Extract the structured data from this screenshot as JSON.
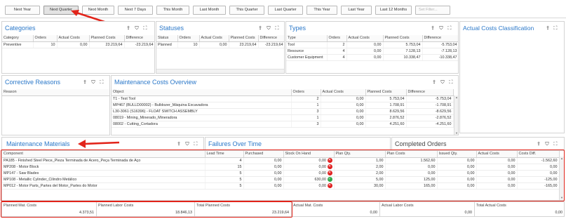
{
  "filters": [
    "Next Year",
    "Next Quarter",
    "Next Month",
    "Next 7 Days",
    "This Month",
    "Last Month",
    "This Quarter",
    "Last Quarter",
    "This Year",
    "Last Year",
    "Last 12 Months"
  ],
  "filter_placeholder": "Set Filter...",
  "panels": {
    "categories": {
      "title": "Categories",
      "headers": [
        "Category",
        "Orders",
        "Actual Costs",
        "Planned Costs",
        "Difference"
      ],
      "rows": [
        [
          "Preventive",
          "10",
          "0,00",
          "23.219,64",
          "-23.219,64"
        ]
      ]
    },
    "statuses": {
      "title": "Statuses",
      "headers": [
        "Status",
        "Orders",
        "Actual Costs",
        "Planned Costs",
        "Difference"
      ],
      "rows": [
        [
          "Planned",
          "10",
          "0,00",
          "23.219,64",
          "-23.219,64"
        ]
      ]
    },
    "types": {
      "title": "Types",
      "headers": [
        "Type",
        "Orders",
        "Actual Costs",
        "Planned Costs",
        "Difference"
      ],
      "rows": [
        [
          "Tool",
          "2",
          "0,00",
          "5.753,04",
          "-5.753,04"
        ],
        [
          "Resource",
          "4",
          "0,00",
          "7.128,13",
          "-7.128,13"
        ],
        [
          "Customer Equipment",
          "4",
          "0,00",
          "10.338,47",
          "-10.338,47"
        ]
      ]
    },
    "actual_costs_classification": {
      "title": "Actual Costs Classification"
    },
    "corrective_reasons": {
      "title": "Corrective Reasons",
      "headers": [
        "Reason"
      ]
    },
    "maintenance_costs_overview": {
      "title": "Maintenance Costs Overview",
      "headers": [
        "Object",
        "Orders",
        "Actual Costs",
        "Planned Costs",
        "Difference"
      ],
      "rows": [
        [
          "T1 - Test Tool",
          "2",
          "0,00",
          "5.753,04",
          "-5.753,04"
        ],
        [
          "MP467 (BULLD00002) - Bulldozer_Máquina Excavadora",
          "1",
          "0,00",
          "1.708,91",
          "-1.708,91"
        ],
        [
          "L30-3061 (S16396) - FLOAT SWITCH ASSEMBLY",
          "3",
          "0,00",
          "8.629,56",
          "-8.629,56"
        ],
        [
          "08019 - Mining_Minerado_Mineradora",
          "1",
          "0,00",
          "2.876,52",
          "-2.876,52"
        ],
        [
          "08002 - Cutting_Cortadora",
          "3",
          "0,00",
          "4.251,60",
          "-4.251,60"
        ]
      ]
    },
    "maintenance_materials": {
      "title": "Maintenance Materials",
      "headers": [
        "Component",
        "Lead Time",
        "Purchased",
        "Stock On Hand",
        "Plan Qty.",
        "Plan Costs",
        "Issued Qty.",
        "Actual Costs",
        "Costs Diff."
      ],
      "rows": [
        [
          "PA185 - Finished Steel Piece_Pieza Terminada de Acero_Peça Terminada de Aço",
          "4",
          "0,00",
          "0,00",
          "bad",
          "1,00",
          "1.562,60",
          "0,00",
          "0,00",
          "-1.562,60"
        ],
        [
          "MP208 - Motor Block",
          "15",
          "0,00",
          "0,00",
          "bad",
          "2,00",
          "0,00",
          "0,00",
          "0,00",
          "0,00"
        ],
        [
          "MP147 - Saw Blades",
          "5",
          "0,00",
          "0,00",
          "bad",
          "2,00",
          "0,00",
          "0,00",
          "0,00",
          "0,00"
        ],
        [
          "MP108 - Metallic Cylinder_Cilindro Metálico",
          "5",
          "0,00",
          "630,00",
          "ok",
          "5,00",
          "125,00",
          "0,00",
          "0,00",
          "-125,00"
        ],
        [
          "MP012 - Motor Parts_Partes del Motor_Partes do Motor",
          "5",
          "0,00",
          "0,00",
          "bad",
          "30,00",
          "165,00",
          "0,00",
          "0,00",
          "-165,00"
        ]
      ],
      "summary": [
        {
          "label": "Planned Mat. Costs",
          "value": "4.373,51"
        },
        {
          "label": "Planned Labor Costs",
          "value": "18.846,13"
        },
        {
          "label": "Total Planned Costs",
          "value": "23.219,64"
        },
        {
          "label": "Actual Mat. Costs",
          "value": "0,00"
        },
        {
          "label": "Actual Labor Costs",
          "value": "0,00"
        },
        {
          "label": "Total Actual Costs",
          "value": "0,00"
        }
      ]
    },
    "failures_over_time": {
      "title": "Failures Over Time"
    },
    "completed_orders": {
      "title": "Completed Orders"
    }
  },
  "colors": {
    "title_blue": "#2b78c9",
    "annotation_red": "#e2241a"
  }
}
